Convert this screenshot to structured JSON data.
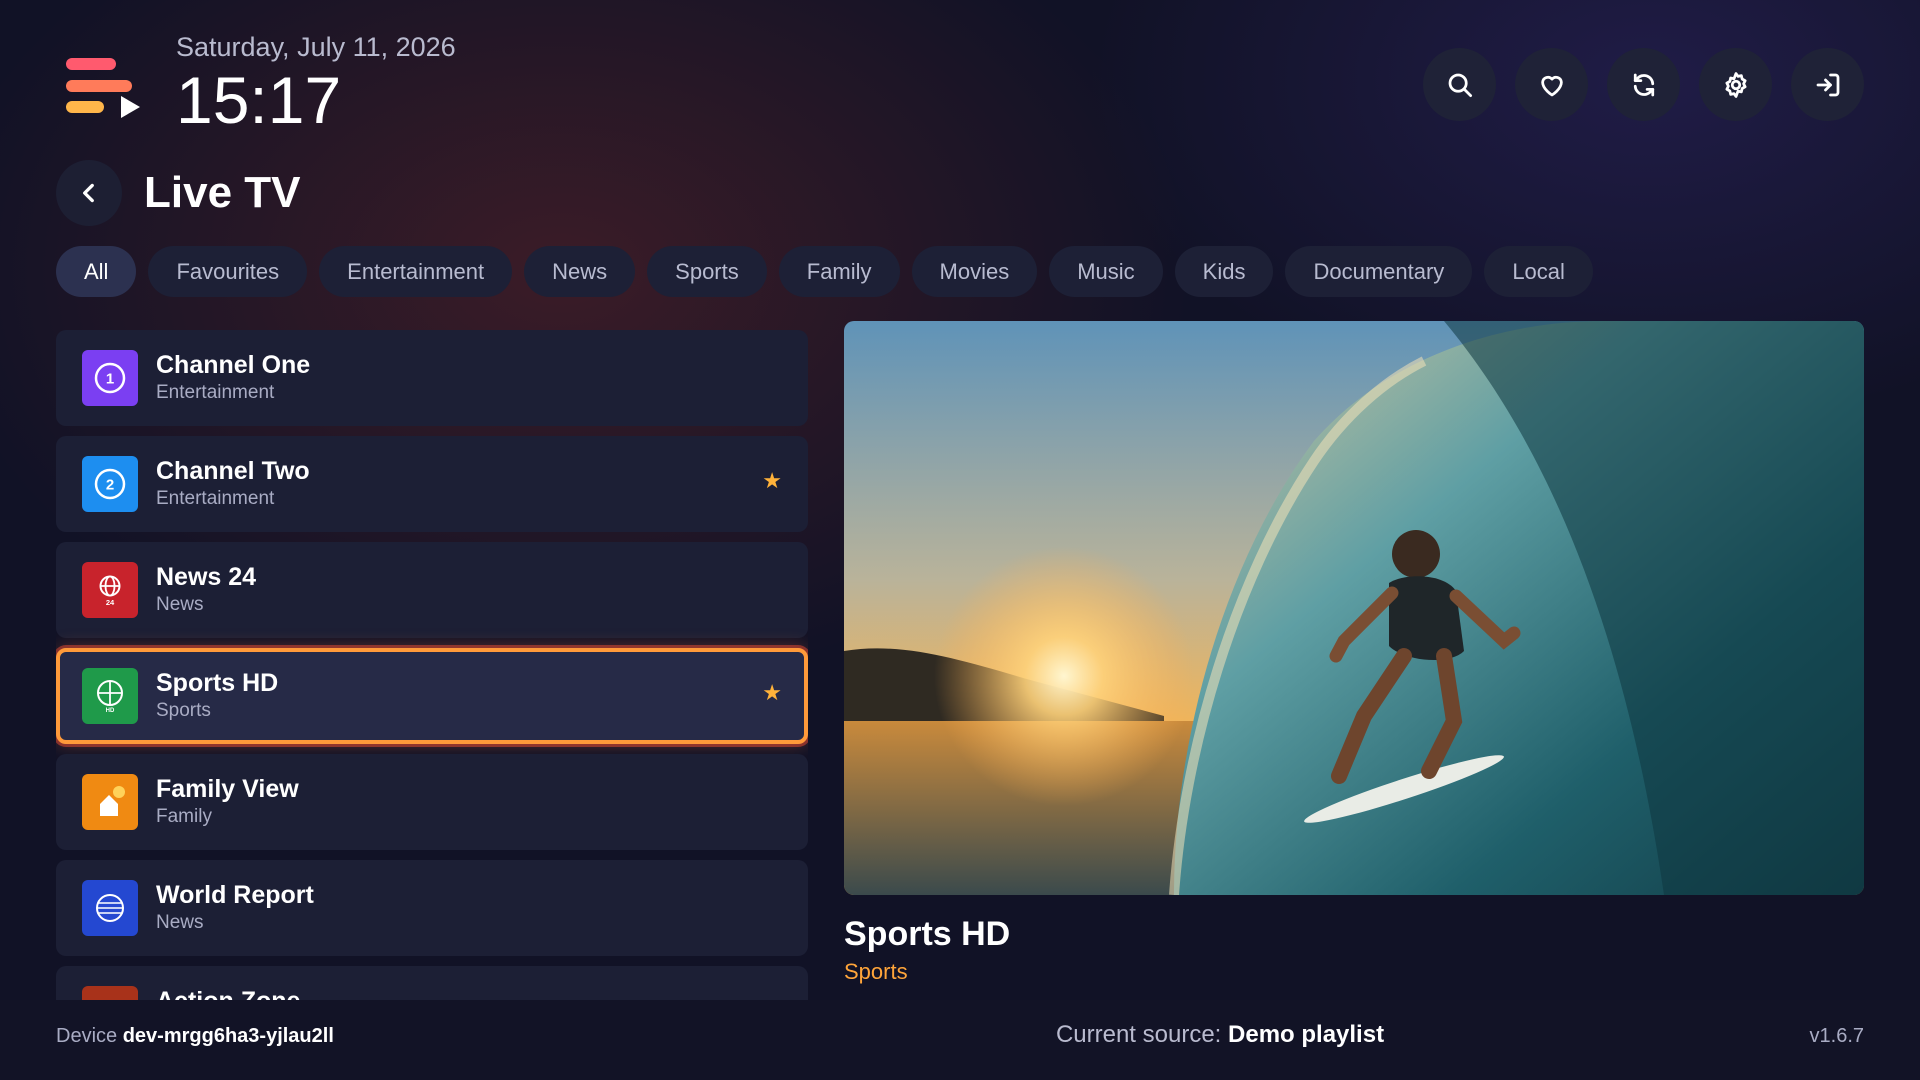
{
  "header": {
    "date": "Saturday, July 11, 2026",
    "time": "15:17",
    "actions": [
      "search-icon",
      "heart-icon",
      "refresh-icon",
      "gear-icon",
      "login-icon"
    ]
  },
  "page": {
    "title": "Live TV"
  },
  "categories": [
    {
      "label": "All",
      "active": true
    },
    {
      "label": "Favourites"
    },
    {
      "label": "Entertainment"
    },
    {
      "label": "News"
    },
    {
      "label": "Sports"
    },
    {
      "label": "Family"
    },
    {
      "label": "Movies"
    },
    {
      "label": "Music"
    },
    {
      "label": "Kids"
    },
    {
      "label": "Documentary"
    },
    {
      "label": "Local"
    }
  ],
  "channels": [
    {
      "name": "Channel One",
      "category": "Entertainment",
      "favourite": false,
      "color": "#7b3ff2"
    },
    {
      "name": "Channel Two",
      "category": "Entertainment",
      "favourite": true,
      "color": "#1d8ef0"
    },
    {
      "name": "News 24",
      "category": "News",
      "favourite": false,
      "color": "#c8232c",
      "logo_text": "24"
    },
    {
      "name": "Sports HD",
      "category": "Sports",
      "favourite": true,
      "selected": true,
      "color": "#1f9a4a",
      "logo_text": "HD"
    },
    {
      "name": "Family View",
      "category": "Family",
      "favourite": false,
      "color": "#f08a12"
    },
    {
      "name": "World Report",
      "category": "News",
      "favourite": false,
      "color": "#2448d1"
    },
    {
      "name": "Action Zone",
      "category": "",
      "favourite": false,
      "color": "#a8321a"
    }
  ],
  "favourite_star": "★",
  "preview": {
    "title": "Sports HD",
    "category": "Sports"
  },
  "footer": {
    "device_label": "Device",
    "device_id": "dev-mrgg6ha3-yjlau2ll",
    "source_label": "Current source:",
    "source_name": "Demo playlist",
    "version": "v1.6.7"
  },
  "colors": {
    "accent": "#ff9a3a",
    "star": "#ffb23a",
    "background": "#111226"
  }
}
